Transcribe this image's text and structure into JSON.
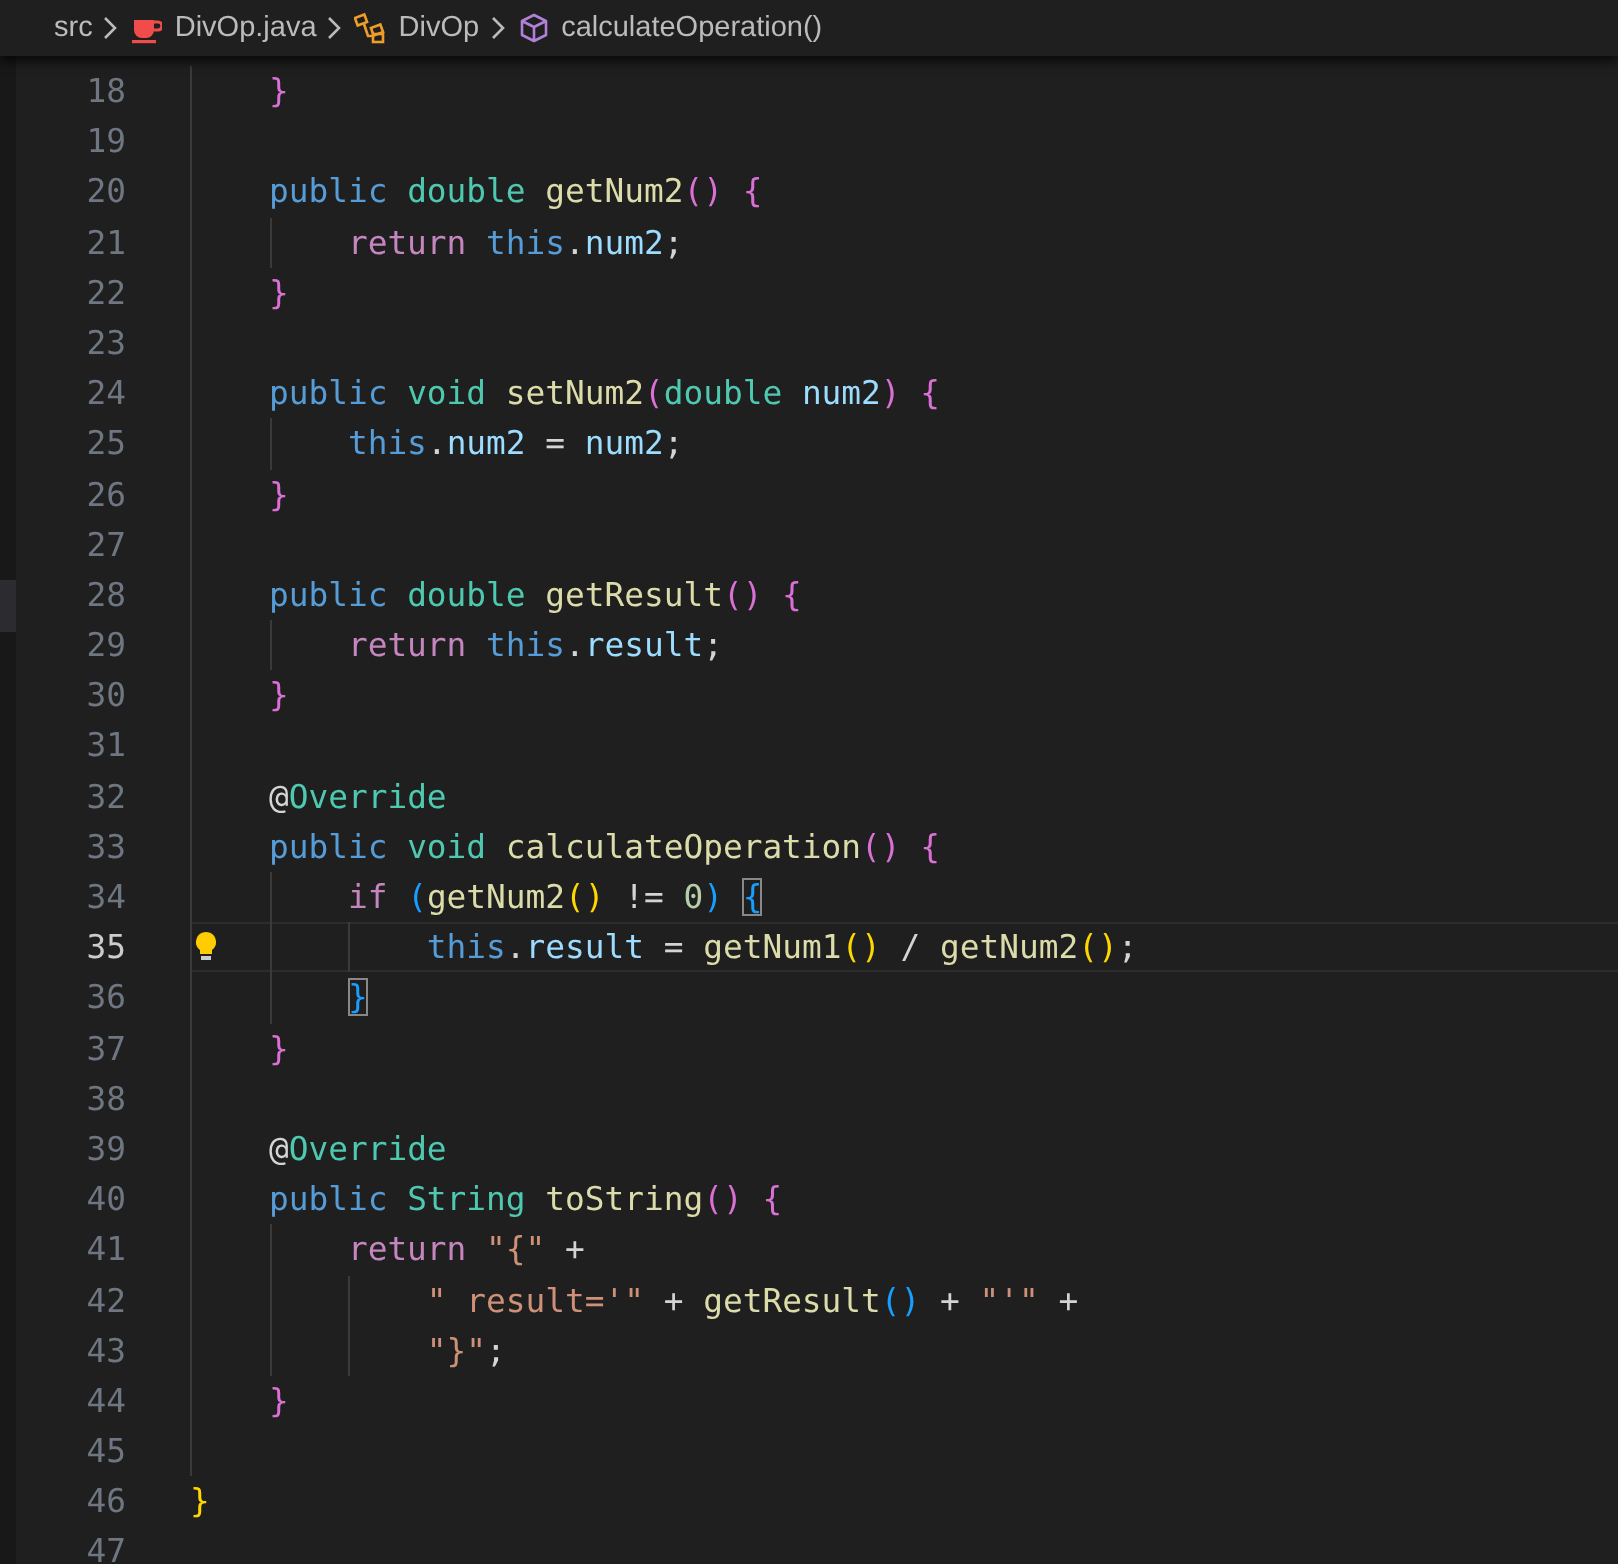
{
  "breadcrumbs": [
    {
      "label": "src",
      "kind": "folder"
    },
    {
      "label": "DivOp.java",
      "kind": "java-file"
    },
    {
      "label": "DivOp",
      "kind": "class"
    },
    {
      "label": "calculateOperation()",
      "kind": "method"
    }
  ],
  "lines": [
    {
      "n": "18",
      "current": false,
      "code": [
        {
          "text": "    }",
          "kind": "p1"
        }
      ]
    },
    {
      "n": "19",
      "current": false
    },
    {
      "n": "20",
      "current": false,
      "code": [
        {
          "text": "    public ",
          "kind": "kw"
        },
        {
          "text": "double ",
          "kind": "type"
        },
        {
          "text": "getNum2",
          "kind": "fn"
        },
        {
          "text": "() {",
          "kind": "p1"
        }
      ]
    },
    {
      "n": "21",
      "current": false,
      "code": [
        {
          "text": "        return ",
          "kind": "ctl"
        },
        {
          "text": "this",
          "kind": "kw"
        },
        {
          "text": ".",
          "kind": "op"
        },
        {
          "text": "num2",
          "kind": "var"
        },
        {
          "text": ";",
          "kind": "op"
        }
      ]
    },
    {
      "n": "22",
      "current": false,
      "code": [
        {
          "text": "    }",
          "kind": "p1"
        }
      ]
    },
    {
      "n": "23",
      "current": false
    },
    {
      "n": "24",
      "current": false,
      "code": [
        {
          "text": "    public ",
          "kind": "kw"
        },
        {
          "text": "void ",
          "kind": "type"
        },
        {
          "text": "setNum2",
          "kind": "fn"
        },
        {
          "text": "(",
          "kind": "p1"
        },
        {
          "text": "double ",
          "kind": "type"
        },
        {
          "text": "num2",
          "kind": "var"
        },
        {
          "text": ") {",
          "kind": "p1"
        }
      ]
    },
    {
      "n": "25",
      "current": false,
      "code": [
        {
          "text": "        this",
          "kind": "kw"
        },
        {
          "text": ".",
          "kind": "op"
        },
        {
          "text": "num2",
          "kind": "var"
        },
        {
          "text": " = ",
          "kind": "op"
        },
        {
          "text": "num2",
          "kind": "var"
        },
        {
          "text": ";",
          "kind": "op"
        }
      ]
    },
    {
      "n": "26",
      "current": false,
      "code": [
        {
          "text": "    }",
          "kind": "p1"
        }
      ]
    },
    {
      "n": "27",
      "current": false
    },
    {
      "n": "28",
      "current": false,
      "code": [
        {
          "text": "    public ",
          "kind": "kw"
        },
        {
          "text": "double ",
          "kind": "type"
        },
        {
          "text": "getResult",
          "kind": "fn"
        },
        {
          "text": "() {",
          "kind": "p1"
        }
      ]
    },
    {
      "n": "29",
      "current": false,
      "code": [
        {
          "text": "        return ",
          "kind": "ctl"
        },
        {
          "text": "this",
          "kind": "kw"
        },
        {
          "text": ".",
          "kind": "op"
        },
        {
          "text": "result",
          "kind": "var"
        },
        {
          "text": ";",
          "kind": "op"
        }
      ]
    },
    {
      "n": "30",
      "current": false,
      "code": [
        {
          "text": "    }",
          "kind": "p1"
        }
      ]
    },
    {
      "n": "31",
      "current": false
    },
    {
      "n": "32",
      "current": false,
      "code": [
        {
          "text": "    @",
          "kind": "op"
        },
        {
          "text": "Override",
          "kind": "type"
        }
      ]
    },
    {
      "n": "33",
      "current": false,
      "code": [
        {
          "text": "    public ",
          "kind": "kw"
        },
        {
          "text": "void ",
          "kind": "type"
        },
        {
          "text": "calculateOperation",
          "kind": "fn"
        },
        {
          "text": "() {",
          "kind": "p1"
        }
      ]
    },
    {
      "n": "34",
      "current": false,
      "code": [
        {
          "text": "        if ",
          "kind": "ctl"
        },
        {
          "text": "(",
          "kind": "p2"
        },
        {
          "text": "getNum2",
          "kind": "fn"
        },
        {
          "text": "()",
          "kind": "p0"
        },
        {
          "text": " != ",
          "kind": "op"
        },
        {
          "text": "0",
          "kind": "num"
        },
        {
          "text": ") ",
          "kind": "p2"
        },
        {
          "text": "{",
          "kind": "p2",
          "matched": true
        }
      ]
    },
    {
      "n": "35",
      "current": true,
      "lightbulb": true,
      "code": [
        {
          "text": "            this",
          "kind": "kw"
        },
        {
          "text": ".",
          "kind": "op"
        },
        {
          "text": "result",
          "kind": "var"
        },
        {
          "text": " = ",
          "kind": "op"
        },
        {
          "text": "getNum1",
          "kind": "fn"
        },
        {
          "text": "()",
          "kind": "p0"
        },
        {
          "text": " / ",
          "kind": "op"
        },
        {
          "text": "getNum2",
          "kind": "fn"
        },
        {
          "text": "()",
          "kind": "p0"
        },
        {
          "text": ";",
          "kind": "op"
        }
      ]
    },
    {
      "n": "36",
      "current": false,
      "code": [
        {
          "text": "        }",
          "kind": "p2",
          "matched": true
        }
      ]
    },
    {
      "n": "37",
      "current": false,
      "code": [
        {
          "text": "    }",
          "kind": "p1"
        }
      ]
    },
    {
      "n": "38",
      "current": false
    },
    {
      "n": "39",
      "current": false,
      "code": [
        {
          "text": "    @",
          "kind": "op"
        },
        {
          "text": "Override",
          "kind": "type"
        }
      ]
    },
    {
      "n": "40",
      "current": false,
      "code": [
        {
          "text": "    public ",
          "kind": "kw"
        },
        {
          "text": "String ",
          "kind": "type"
        },
        {
          "text": "toString",
          "kind": "fn"
        },
        {
          "text": "() {",
          "kind": "p1"
        }
      ]
    },
    {
      "n": "41",
      "current": false,
      "code": [
        {
          "text": "        return ",
          "kind": "ctl"
        },
        {
          "text": "\"{\"",
          "kind": "str"
        },
        {
          "text": " +",
          "kind": "op"
        }
      ]
    },
    {
      "n": "42",
      "current": false,
      "code": [
        {
          "text": "            \" result='\"",
          "kind": "str"
        },
        {
          "text": " + ",
          "kind": "op"
        },
        {
          "text": "getResult",
          "kind": "fn"
        },
        {
          "text": "()",
          "kind": "p2"
        },
        {
          "text": " + ",
          "kind": "op"
        },
        {
          "text": "\"'\"",
          "kind": "str"
        },
        {
          "text": " +",
          "kind": "op"
        }
      ]
    },
    {
      "n": "43",
      "current": false,
      "code": [
        {
          "text": "            \"}\"",
          "kind": "str"
        },
        {
          "text": ";",
          "kind": "op"
        }
      ]
    },
    {
      "n": "44",
      "current": false,
      "code": [
        {
          "text": "    }",
          "kind": "p1"
        }
      ]
    },
    {
      "n": "45",
      "current": false
    },
    {
      "n": "46",
      "current": false,
      "code": [
        {
          "text": "}",
          "kind": "p0"
        }
      ]
    },
    {
      "n": "47",
      "current": false
    }
  ]
}
